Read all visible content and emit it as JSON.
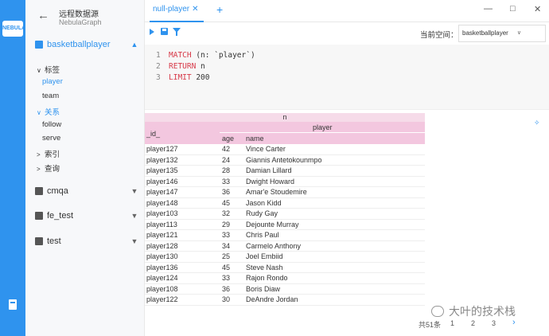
{
  "rail": {
    "logo_text": "NEBULA"
  },
  "sidebar": {
    "datasource_title": "远程数据源",
    "datasource_sub": "NebulaGraph",
    "spaces": [
      {
        "label": "basketballplayer",
        "active": true
      },
      {
        "label": "cmqa"
      },
      {
        "label": "fe_test"
      },
      {
        "label": "test"
      }
    ],
    "tree": {
      "tags_label": "标签",
      "tags": [
        "player",
        "team"
      ],
      "edges_label": "关系",
      "edges": [
        "follow",
        "serve"
      ],
      "index_label": "索引",
      "query_label": "查询"
    }
  },
  "tabs": [
    {
      "label": "null-player"
    }
  ],
  "toolbar": {
    "space_label": "当前空间：",
    "space_value": "basketballplayer"
  },
  "editor": {
    "lines": [
      {
        "num": "1",
        "kw": "MATCH",
        "rest": " (n: `player`)"
      },
      {
        "num": "2",
        "kw": "RETURN",
        "rest": " n"
      },
      {
        "num": "3",
        "kw": "LIMIT",
        "rest": " 200"
      }
    ]
  },
  "result": {
    "header_n": "n",
    "header_player": "player",
    "col_id": "_id_",
    "col_age": "age",
    "col_name": "name",
    "rows": [
      [
        "player127",
        "42",
        "Vince Carter"
      ],
      [
        "player132",
        "24",
        "Giannis Antetokounmpo"
      ],
      [
        "player135",
        "28",
        "Damian Lillard"
      ],
      [
        "player146",
        "33",
        "Dwight Howard"
      ],
      [
        "player147",
        "36",
        "Amar'e Stoudemire"
      ],
      [
        "player148",
        "45",
        "Jason Kidd"
      ],
      [
        "player103",
        "32",
        "Rudy Gay"
      ],
      [
        "player113",
        "29",
        "Dejounte Murray"
      ],
      [
        "player121",
        "33",
        "Chris Paul"
      ],
      [
        "player128",
        "34",
        "Carmelo Anthony"
      ],
      [
        "player130",
        "25",
        "Joel Embiid"
      ],
      [
        "player136",
        "45",
        "Steve Nash"
      ],
      [
        "player124",
        "33",
        "Rajon Rondo"
      ],
      [
        "player108",
        "36",
        "Boris Diaw"
      ],
      [
        "player122",
        "30",
        "DeAndre Jordan"
      ]
    ]
  },
  "pagination": {
    "total": "共51条",
    "pages": [
      "1",
      "2",
      "3"
    ],
    "next": "›"
  },
  "watermark": "大叶的技术栈",
  "colors": {
    "accent": "#2f93ee",
    "header_pink": "#f3c7df",
    "keyword": "#d73a49"
  }
}
